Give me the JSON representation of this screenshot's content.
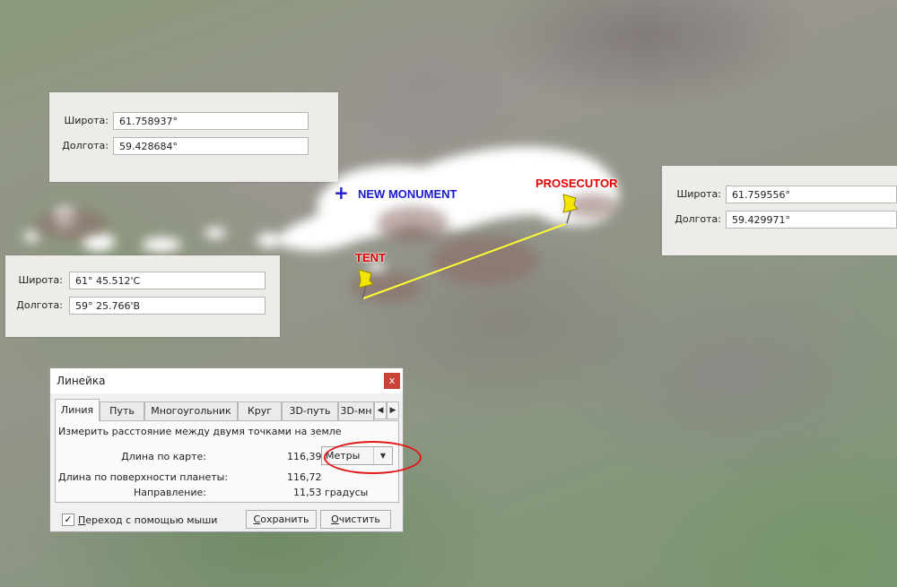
{
  "map": {
    "labels": {
      "new_monument": "NEW MONUMENT",
      "tent": "TENT",
      "prosecutor": "PROSECUTOR"
    },
    "label_colors": {
      "new_monument": "#1a1ad0",
      "tent_prosecutor": "#e00000",
      "measure_line": "#ffff33"
    },
    "markers": [
      "plus-icon",
      "pushpin-icon",
      "pushpin-icon"
    ]
  },
  "panels": {
    "top_left": {
      "lat_label": "Широта:",
      "lat_value": "61.758937°",
      "lon_label": "Долгота:",
      "lon_value": "59.428684°"
    },
    "right": {
      "lat_label": "Широта:",
      "lat_value": "61.759556°",
      "lon_label": "Долгота:",
      "lon_value": "59.429971°"
    },
    "left": {
      "lat_label": "Широта:",
      "lat_value": "61° 45.512'С",
      "lon_label": "Долгота:",
      "lon_value": "59° 25.766'В"
    }
  },
  "ruler": {
    "title": "Линейка",
    "close": "x",
    "tabs": [
      "Линия",
      "Путь",
      "Многоугольник",
      "Круг",
      "3D-путь",
      "3D-мн"
    ],
    "active_tab": "Линия",
    "description": "Измерить расстояние между двумя точками на земле",
    "map_length_label": "Длина по карте:",
    "map_length_value": "116,39",
    "units": "Метры",
    "surface_length_label": "Длина по поверхности планеты:",
    "surface_length_value": "116,72",
    "direction_label": "Направление:",
    "direction_value": "11,53 градусы",
    "mouse_nav_label": "Переход с помощью мыши",
    "mouse_nav_checked": true,
    "save_label": "Сохранить",
    "clear_label": "Очистить",
    "highlight_color": "#e01818"
  }
}
